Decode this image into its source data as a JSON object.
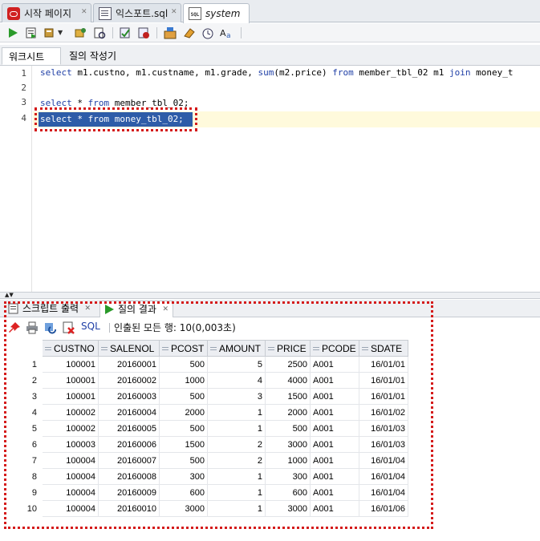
{
  "doc_tabs": [
    {
      "label": "시작 페이지",
      "icon": "oracle-icon"
    },
    {
      "label": "익스포트.sql",
      "icon": "document-icon"
    },
    {
      "label": "system",
      "icon": "sql-worksheet-icon"
    }
  ],
  "sub_tabs": {
    "worksheet": "워크시트",
    "query_builder": "질의 작성기"
  },
  "editor": {
    "line_numbers": [
      "1",
      "2",
      "3",
      "4"
    ],
    "line1": {
      "kw1": "select",
      "t1": " m1.custno, m1.custname, m1.grade, ",
      "fn": "sum",
      "t2": "(m2.price) ",
      "kw2": "from",
      "t3": " member_tbl_02 m1 ",
      "kw3": "join",
      "t4": " money_t"
    },
    "line3": {
      "kw1": "select",
      "t1": " * ",
      "kw2": "from",
      "t2": " member_tbl_02;"
    },
    "line4": "select * from money_tbl_02;"
  },
  "result_tabs": {
    "script_output": "스크립트 출력",
    "query_result": "질의 결과"
  },
  "result_toolbar": {
    "sql_label": "SQL",
    "status": "인출된 모든 행: 10(0,003초)"
  },
  "table": {
    "columns": [
      "CUSTNO",
      "SALENOL",
      "PCOST",
      "AMOUNT",
      "PRICE",
      "PCODE",
      "SDATE"
    ],
    "rows": [
      [
        "1",
        "100001",
        "20160001",
        "500",
        "5",
        "2500",
        "A001",
        "16/01/01"
      ],
      [
        "2",
        "100001",
        "20160002",
        "1000",
        "4",
        "4000",
        "A001",
        "16/01/01"
      ],
      [
        "3",
        "100001",
        "20160003",
        "500",
        "3",
        "1500",
        "A001",
        "16/01/01"
      ],
      [
        "4",
        "100002",
        "20160004",
        "2000",
        "1",
        "2000",
        "A001",
        "16/01/02"
      ],
      [
        "5",
        "100002",
        "20160005",
        "500",
        "1",
        "500",
        "A001",
        "16/01/03"
      ],
      [
        "6",
        "100003",
        "20160006",
        "1500",
        "2",
        "3000",
        "A001",
        "16/01/03"
      ],
      [
        "7",
        "100004",
        "20160007",
        "500",
        "2",
        "1000",
        "A001",
        "16/01/04"
      ],
      [
        "8",
        "100004",
        "20160008",
        "300",
        "1",
        "300",
        "A001",
        "16/01/04"
      ],
      [
        "9",
        "100004",
        "20160009",
        "600",
        "1",
        "600",
        "A001",
        "16/01/04"
      ],
      [
        "10",
        "100004",
        "20160010",
        "3000",
        "1",
        "3000",
        "A001",
        "16/01/06"
      ]
    ]
  }
}
